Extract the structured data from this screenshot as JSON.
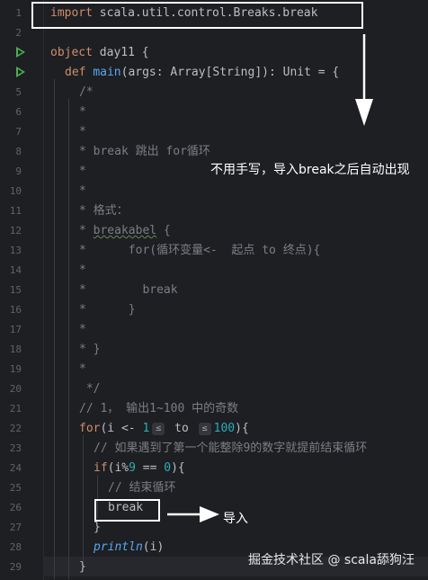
{
  "editor": {
    "line_numbers": [
      "1",
      "2",
      "3",
      "4",
      "5",
      "6",
      "7",
      "8",
      "9",
      "10",
      "11",
      "12",
      "13",
      "14",
      "15",
      "16",
      "17",
      "18",
      "19",
      "20",
      "21",
      "22",
      "23",
      "24",
      "25",
      "26",
      "27",
      "28",
      "29"
    ],
    "lines": {
      "l1": {
        "kw": "import",
        "rest": " scala.util.control.Breaks.break"
      },
      "l3": {
        "kw": "object",
        "rest": " day11 {"
      },
      "l4": {
        "kw": "def",
        "fn": "main",
        "rest": "(args: Array[String]): Unit = {"
      },
      "l5": "/*",
      "l6": "*",
      "l7": "*",
      "l8": "* break 跳出 for循环",
      "l9": "*",
      "l10": "*",
      "l11": "* 格式：",
      "l12": {
        "star": "* ",
        "warn": "breakabel",
        "rest": " {"
      },
      "l13": "*      for(循环变量<-  起点 to 终点){",
      "l14": "*",
      "l15": "*        break",
      "l16": "*      }",
      "l17": "*",
      "l18": "* }",
      "l19": "*",
      "l20": " */",
      "l21": "// 1， 输出1~100 中的奇数",
      "l22": {
        "kw": "for",
        "a": "(i <- ",
        "n1": "1",
        "hint1": "≤",
        "b": " to ",
        "hint2": "≤",
        "n2": "100",
        "c": "){"
      },
      "l23": "// 如果遇到了第一个能整除9的数字就提前结束循环",
      "l24": {
        "kw": "if",
        "a": "(i%",
        "n1": "9",
        "b": " == ",
        "n2": "0",
        "c": "){"
      },
      "l25": "// 结束循环",
      "l26": "break",
      "l27": "}",
      "l28": {
        "fn": "println",
        "rest": "(i)"
      },
      "l29": "}"
    }
  },
  "annotations": {
    "top_note": "不用手写，导入break之后自动出现",
    "import_note": "导入"
  },
  "watermark": "掘金技术社区 @ scala舔狗汪",
  "colors": {
    "background": "#1e1f22",
    "keyword": "#cf8e6d",
    "comment": "#7a7e85",
    "number": "#2aacb8",
    "function": "#56a8f5",
    "run_icon": "#4caf50"
  }
}
